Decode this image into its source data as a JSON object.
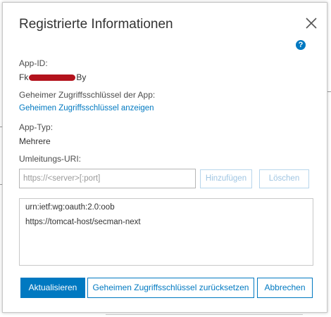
{
  "dialog": {
    "title": "Registrierte Informationen",
    "close_icon": "close-icon",
    "help_icon": "help-icon",
    "help_glyph": "?"
  },
  "app_id": {
    "label": "App-ID:",
    "value_prefix": "Fk",
    "value_suffix": "By",
    "redacted": true
  },
  "secret": {
    "label": "Geheimer Zugriffsschlüssel der App:",
    "show_link": "Geheimen Zugriffsschlüssel anzeigen"
  },
  "app_type": {
    "label": "App-Typ:",
    "value": "Mehrere"
  },
  "redirect": {
    "label": "Umleitungs-URI:",
    "input_placeholder": "https://<server>[:port]",
    "input_value": "",
    "add_button": "Hinzufügen",
    "delete_button": "Löschen",
    "uris": [
      "urn:ietf:wg:oauth:2.0:oob",
      "https://tomcat-host/secman-next"
    ]
  },
  "footer": {
    "update_button": "Aktualisieren",
    "reset_button": "Geheimen Zugriffsschlüssel zurücksetzen",
    "cancel_button": "Abbrechen"
  },
  "colors": {
    "accent": "#0079c1",
    "redaction": "#b3121c",
    "disabled_text": "#9fc5e2"
  }
}
